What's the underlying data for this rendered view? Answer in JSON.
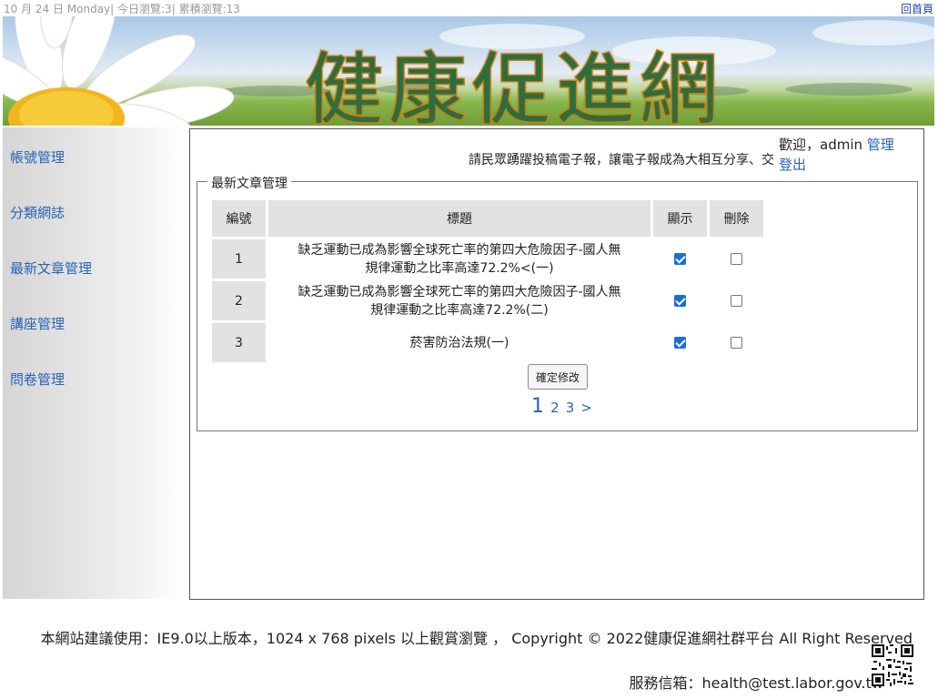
{
  "topbar": {
    "status": "10 月 24 日 Monday| 今日瀏覽:3| 累積瀏覽:13",
    "home_link": "回首頁"
  },
  "banner": {
    "title": "健康促進網"
  },
  "sidebar": {
    "items": [
      {
        "label": "帳號管理"
      },
      {
        "label": "分類網誌"
      },
      {
        "label": "最新文章管理"
      },
      {
        "label": "講座管理"
      },
      {
        "label": "問卷管理"
      }
    ]
  },
  "user": {
    "welcome": "歡迎，admin",
    "manage_link": "管理",
    "logout_link": "登出"
  },
  "marquee": {
    "text": "請民眾踴躍投稿電子報，讓電子報成為大相互分享、交"
  },
  "panel": {
    "legend": "最新文章管理",
    "columns": {
      "number": "編號",
      "title": "標題",
      "show": "顯示",
      "delete": "刪除"
    },
    "rows": [
      {
        "number": "1",
        "title_line1": "缺乏運動已成為影響全球死亡率的第四大危險因子-國人無",
        "title_line2": "規律運動之比率高達72.2%<(一)",
        "show": true,
        "delete": false
      },
      {
        "number": "2",
        "title_line1": "缺乏運動已成為影響全球死亡率的第四大危險因子-國人無",
        "title_line2": "規律運動之比率高達72.2%(二)",
        "show": true,
        "delete": false
      },
      {
        "number": "3",
        "title_line1": "菸害防治法規(一)",
        "title_line2": "",
        "show": true,
        "delete": false
      }
    ],
    "submit_label": "確定修改",
    "pager": {
      "current": "1",
      "pages": [
        "2",
        "3",
        ">"
      ]
    }
  },
  "footer": {
    "line1": "本網站建議使用：IE9.0以上版本，1024 x 768 pixels 以上觀賞瀏覽 ， Copyright © 2022健康促進網社群平台 All Right Reserved",
    "line2": "服務信箱：health@test.labor.gov.tw"
  },
  "colors": {
    "link": "#2a63b8",
    "checkbox_checked": "#1a6fd6",
    "header_cell": "#e2e2e2",
    "banner_title_fill": "#2e6d3d",
    "banner_title_stroke": "#d88a1a"
  }
}
